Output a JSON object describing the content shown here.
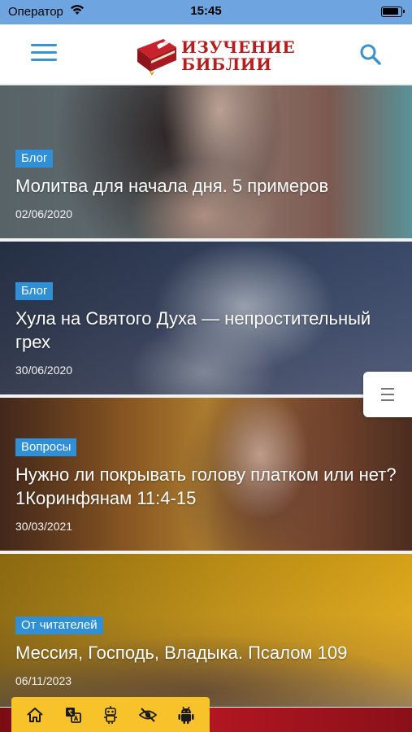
{
  "status_bar": {
    "carrier": "Оператор",
    "time": "15:45",
    "wifi_icon": "wifi-icon",
    "battery_icon": "battery-icon"
  },
  "header": {
    "logo_line1": "ИЗУЧЕНИЕ",
    "logo_line2": "БИБЛИИ",
    "menu_icon": "hamburger-menu-icon",
    "search_icon": "search-icon",
    "accent_color": "#3a93d0",
    "logo_color": "#b31e1e"
  },
  "posts": [
    {
      "tag": "Блог",
      "title": "Молитва для начала дня. 5 примеров",
      "date": "02/06/2020"
    },
    {
      "tag": "Блог",
      "title": "Хула на Святого Духа — непростительный грех",
      "date": "30/06/2020"
    },
    {
      "tag": "Вопросы",
      "title": "Нужно ли покрывать голову платком или нет? 1Коринфянам 11:4-15",
      "date": "30/03/2021"
    },
    {
      "tag": "От читателей",
      "title": "Мессия, Господь, Владыка. Псалом 109",
      "date": "06/11/2023"
    }
  ],
  "tag_color": "#2f90d8",
  "side_menu_icon": "list-icon",
  "accessibility_bar": {
    "color": "#f7c22a",
    "buttons": [
      "home-icon",
      "translate-icon",
      "robot-icon",
      "eye-slash-icon",
      "android-icon"
    ]
  }
}
